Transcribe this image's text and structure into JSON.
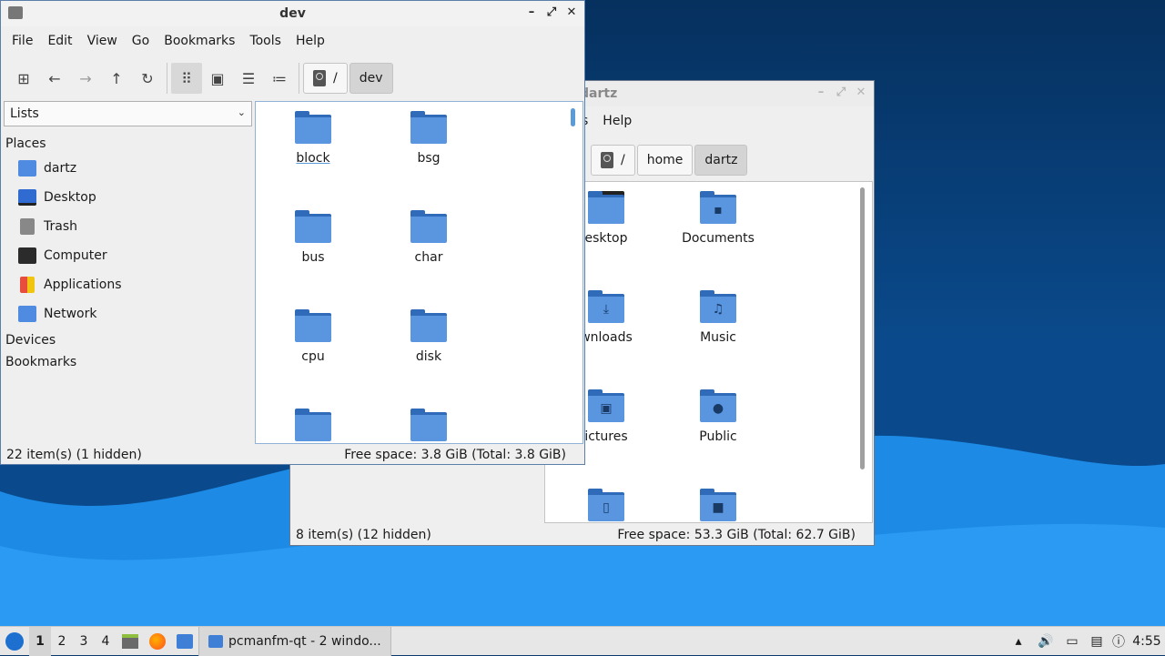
{
  "back_window": {
    "title_partial": "dartz",
    "menu_visible": [
      "s",
      "Help"
    ],
    "breadcrumb": [
      "/",
      "home",
      "dartz"
    ],
    "files": [
      {
        "label": "esktop",
        "glyph": ""
      },
      {
        "label": "Documents",
        "glyph": "▪"
      },
      {
        "label": "wnloads",
        "glyph": "⤓"
      },
      {
        "label": "Music",
        "glyph": "♫"
      },
      {
        "label": "ictures",
        "glyph": "▣"
      },
      {
        "label": "Public",
        "glyph": "●"
      },
      {
        "label": "",
        "glyph": "▯"
      },
      {
        "label": "",
        "glyph": "■"
      }
    ],
    "status_left": "8 item(s) (12 hidden)",
    "status_right": "Free space: 53.3 GiB (Total: 62.7 GiB)"
  },
  "front_window": {
    "title": "dev",
    "menu": [
      "File",
      "Edit",
      "View",
      "Go",
      "Bookmarks",
      "Tools",
      "Help"
    ],
    "toolbar_icons": [
      "new-tab-icon",
      "back-icon",
      "forward-icon",
      "up-icon",
      "reload-icon",
      "icon-view-icon",
      "thumbnail-view-icon",
      "compact-view-icon",
      "detailed-list-icon"
    ],
    "breadcrumb": [
      "/",
      "dev"
    ],
    "side_mode": "Lists",
    "places_header": "Places",
    "places": [
      {
        "label": "dartz",
        "icon": "home-folder-icon"
      },
      {
        "label": "Desktop",
        "icon": "desktop-icon"
      },
      {
        "label": "Trash",
        "icon": "trash-icon"
      },
      {
        "label": "Computer",
        "icon": "computer-icon"
      },
      {
        "label": "Applications",
        "icon": "applications-icon"
      },
      {
        "label": "Network",
        "icon": "network-icon"
      }
    ],
    "devices_header": "Devices",
    "bookmarks_header": "Bookmarks",
    "files": [
      "block",
      "bsg",
      "bus",
      "char",
      "cpu",
      "disk",
      "",
      ""
    ],
    "status_left": "22 item(s) (1 hidden)",
    "status_right": "Free space: 3.8 GiB (Total: 3.8 GiB)"
  },
  "taskbar": {
    "desktops": [
      "1",
      "2",
      "3",
      "4"
    ],
    "active_desktop": "1",
    "task_label": "pcmanfm-qt - 2 windo...",
    "clock": "4:55"
  },
  "colors": {
    "folder": "#5a95e0",
    "folder_dark": "#2f6bb8",
    "accent": "#5b9bd8"
  }
}
